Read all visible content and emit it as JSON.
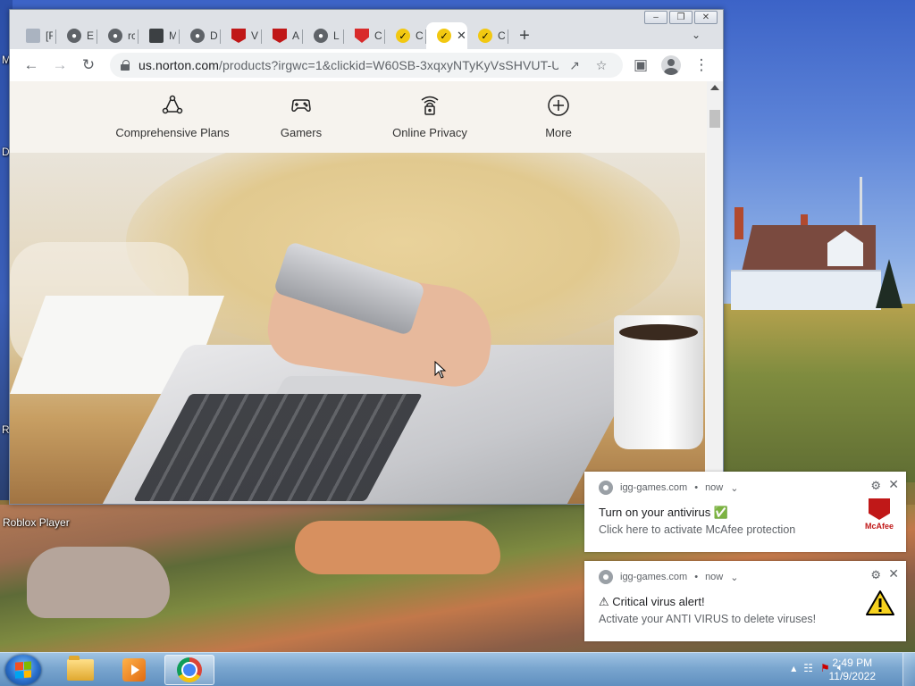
{
  "desktop": {
    "labels": [
      "M",
      "D",
      "R"
    ],
    "roblox_label": "Roblox Player"
  },
  "browser": {
    "tabs": [
      {
        "title": "[F",
        "icon": "page-icon"
      },
      {
        "title": "E",
        "icon": "globe-icon"
      },
      {
        "title": "rc",
        "icon": "globe-icon"
      },
      {
        "title": "M",
        "icon": "film-icon"
      },
      {
        "title": "D",
        "icon": "globe-icon"
      },
      {
        "title": "V",
        "icon": "mcafee-icon"
      },
      {
        "title": "A",
        "icon": "mcafee-icon"
      },
      {
        "title": "L",
        "icon": "globe-icon"
      },
      {
        "title": "C",
        "icon": "shield-icon"
      },
      {
        "title": "C",
        "icon": "norton-icon"
      },
      {
        "title": "",
        "icon": "norton-icon"
      },
      {
        "title": "C",
        "icon": "norton-icon"
      }
    ],
    "active_tab_index": 10,
    "new_tab_symbol": "+",
    "url_host": "us.norton.com",
    "url_path": "/products?irgwc=1&clickid=W60SB-3xqxyNTyKyVsSHVUT-U...",
    "categories": [
      {
        "label": "Comprehensive Plans",
        "icon": "network-icon"
      },
      {
        "label": "Gamers",
        "icon": "gamepad-icon"
      },
      {
        "label": "Online Privacy",
        "icon": "privacy-lock-icon"
      },
      {
        "label": "More",
        "icon": "plus-circle-icon"
      }
    ]
  },
  "notifications": [
    {
      "source": "igg-games.com",
      "time": "now",
      "title": "Turn on your antivirus ✅",
      "body": "Click here to activate McAfee protection",
      "logo_text": "McAfee",
      "icon": "mcafee-shield-icon"
    },
    {
      "source": "igg-games.com",
      "time": "now",
      "title": "⚠ Critical virus alert!",
      "body": "Activate your ANTI VIRUS to delete viruses!",
      "icon": "warning-triangle-icon"
    }
  ],
  "taskbar": {
    "time": "2:49 PM",
    "date": "11/9/2022",
    "apps": [
      "file-explorer",
      "media-player",
      "chrome"
    ]
  },
  "colors": {
    "mcafee_red": "#c01818",
    "norton_yellow": "#f2c811",
    "page_bg": "#f6f3ee"
  }
}
